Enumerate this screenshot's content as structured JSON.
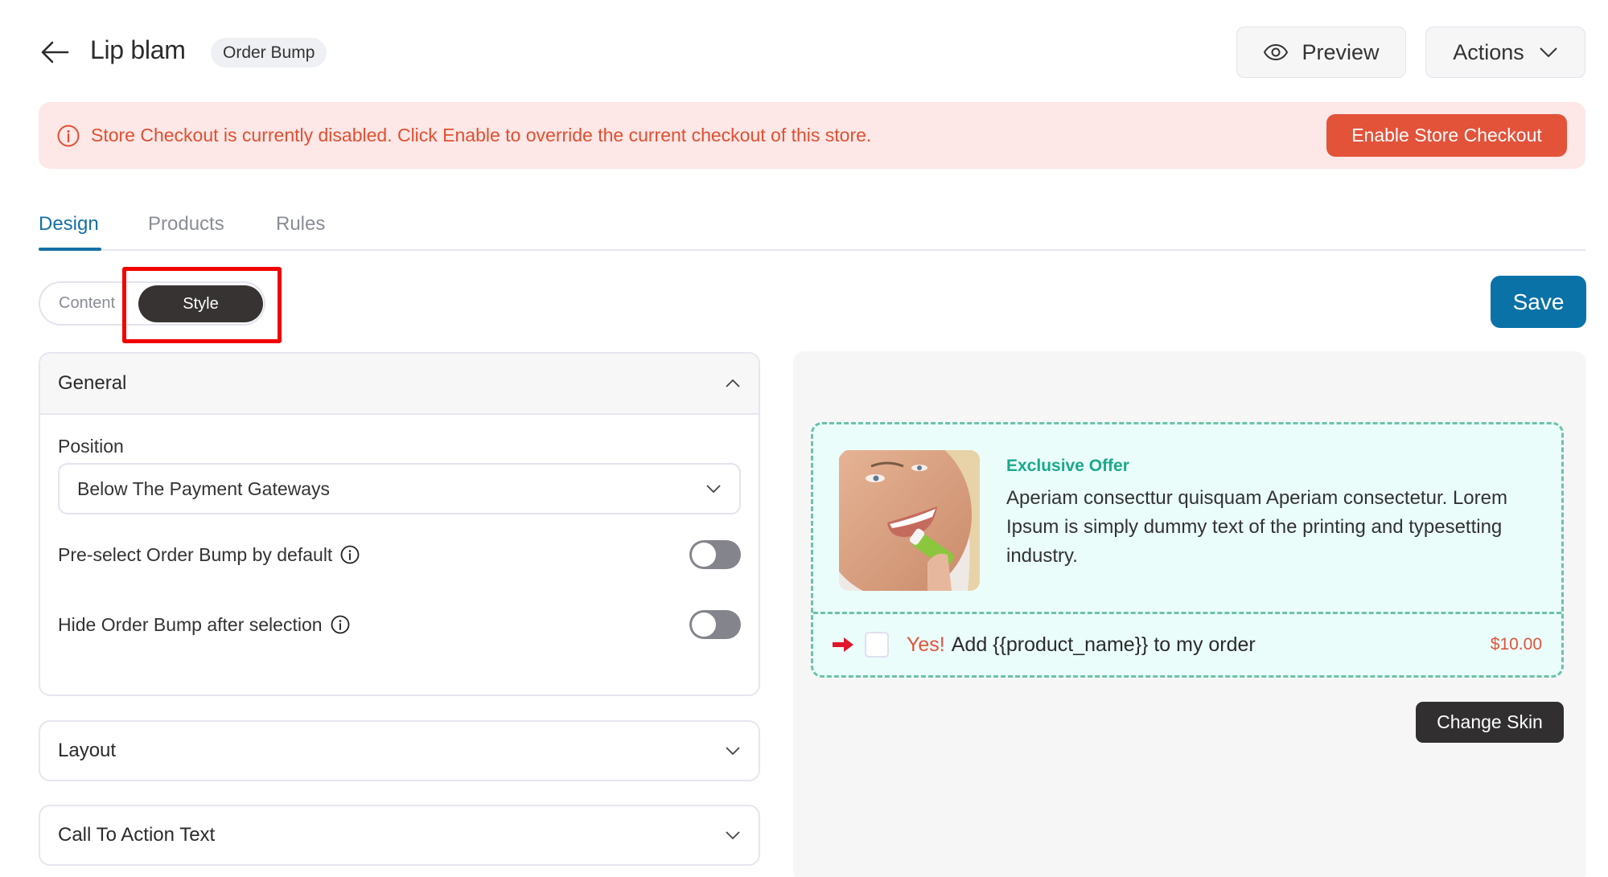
{
  "header": {
    "back_icon": "arrow-left-icon",
    "title": "Lip blam",
    "badge": "Order Bump",
    "preview_label": "Preview",
    "preview_icon": "eye-icon",
    "actions_label": "Actions",
    "actions_icon": "chevron-down-icon"
  },
  "alert": {
    "icon": "info-circle-icon",
    "message": "Store Checkout is currently disabled. Click Enable to override the current checkout of this store.",
    "button_label": "Enable Store Checkout",
    "bg_color": "#fde7e7",
    "text_color": "#e05030",
    "button_color": "#e2533a"
  },
  "tabs": [
    {
      "label": "Design",
      "active": true
    },
    {
      "label": "Products",
      "active": false
    },
    {
      "label": "Rules",
      "active": false
    }
  ],
  "segmented": {
    "options": [
      {
        "label": "Content",
        "active": false
      },
      {
        "label": "Style",
        "active": true
      }
    ]
  },
  "save_label": "Save",
  "settings": {
    "general": {
      "title": "General",
      "expanded": true,
      "position_label": "Position",
      "position_value": "Below The Payment Gateways",
      "toggles": [
        {
          "label": "Pre-select Order Bump by default",
          "on": false
        },
        {
          "label": "Hide Order Bump after selection",
          "on": false
        }
      ]
    },
    "layout": {
      "title": "Layout",
      "expanded": false
    },
    "cta": {
      "title": "Call To Action Text",
      "expanded": false
    }
  },
  "preview": {
    "image_alt": "Woman applying green lip balm",
    "offer_title": "Exclusive Offer",
    "description": "Aperiam consecttur quisquam Aperiam consectetur. Lorem Ipsum is simply dummy text of the printing and typesetting industry.",
    "cta_yes": "Yes!",
    "cta_text": "Add {{product_name}} to my order",
    "price": "$10.00",
    "checked": false,
    "change_skin_label": "Change Skin",
    "accent_color": "#1aa98a",
    "border_color": "#6cc3a9"
  },
  "colors": {
    "primary": "#0b72a8",
    "dark": "#363332",
    "highlight": "#f20000"
  }
}
